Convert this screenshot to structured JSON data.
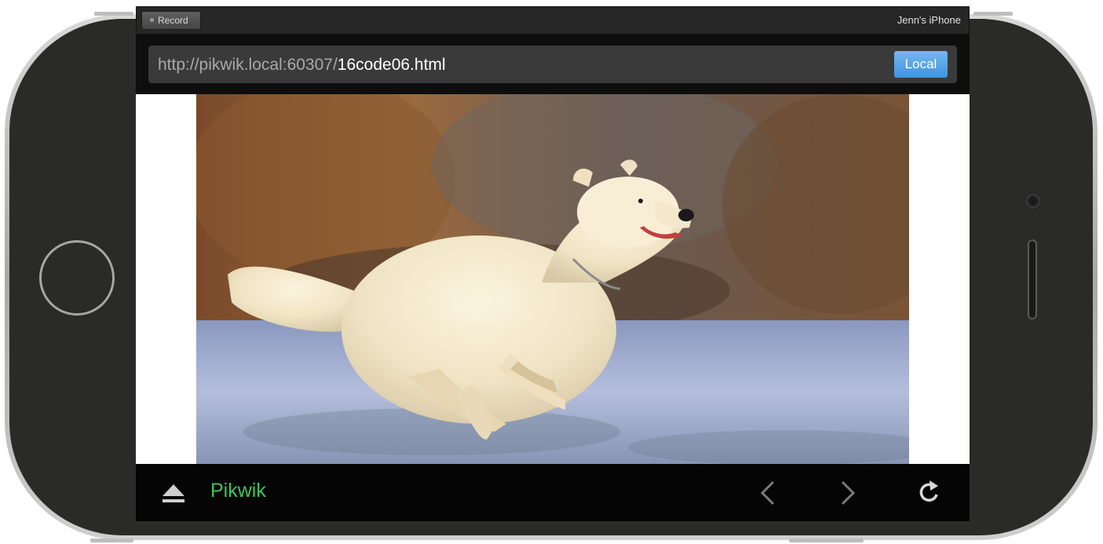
{
  "simulator": {
    "record_label": "Record",
    "device_name": "Jenn's iPhone"
  },
  "browser": {
    "url_host": "http://pikwik.local:60307/",
    "url_file": "16code06.html",
    "local_label": "Local"
  },
  "toolbar": {
    "app_name": "Pikwik",
    "icons": [
      "eject-icon",
      "back-chevron-icon",
      "forward-chevron-icon",
      "reload-icon"
    ]
  },
  "content": {
    "image_subject": "white dog running on frosty grass"
  },
  "colors": {
    "accent_green": "#3ec45a",
    "local_button_blue": "#4a9be3"
  }
}
